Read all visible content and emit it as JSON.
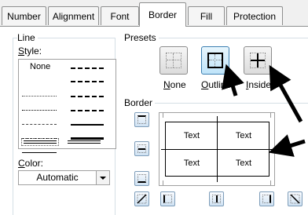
{
  "tabs": [
    "Number",
    "Alignment",
    "Font",
    "Border",
    "Fill",
    "Protection"
  ],
  "line": {
    "group_label": "Line",
    "style_label": "Style:",
    "none_label": "None",
    "color_label": "Color:",
    "color_value": "Automatic"
  },
  "presets": {
    "group_label": "Presets",
    "none": "None",
    "outline": "Outline",
    "inside": "Inside"
  },
  "border": {
    "group_label": "Border",
    "preview_cells": [
      "Text",
      "Text",
      "Text",
      "Text"
    ]
  },
  "colors": {
    "accent": "#3c7fb1",
    "arrow": "#000000"
  }
}
